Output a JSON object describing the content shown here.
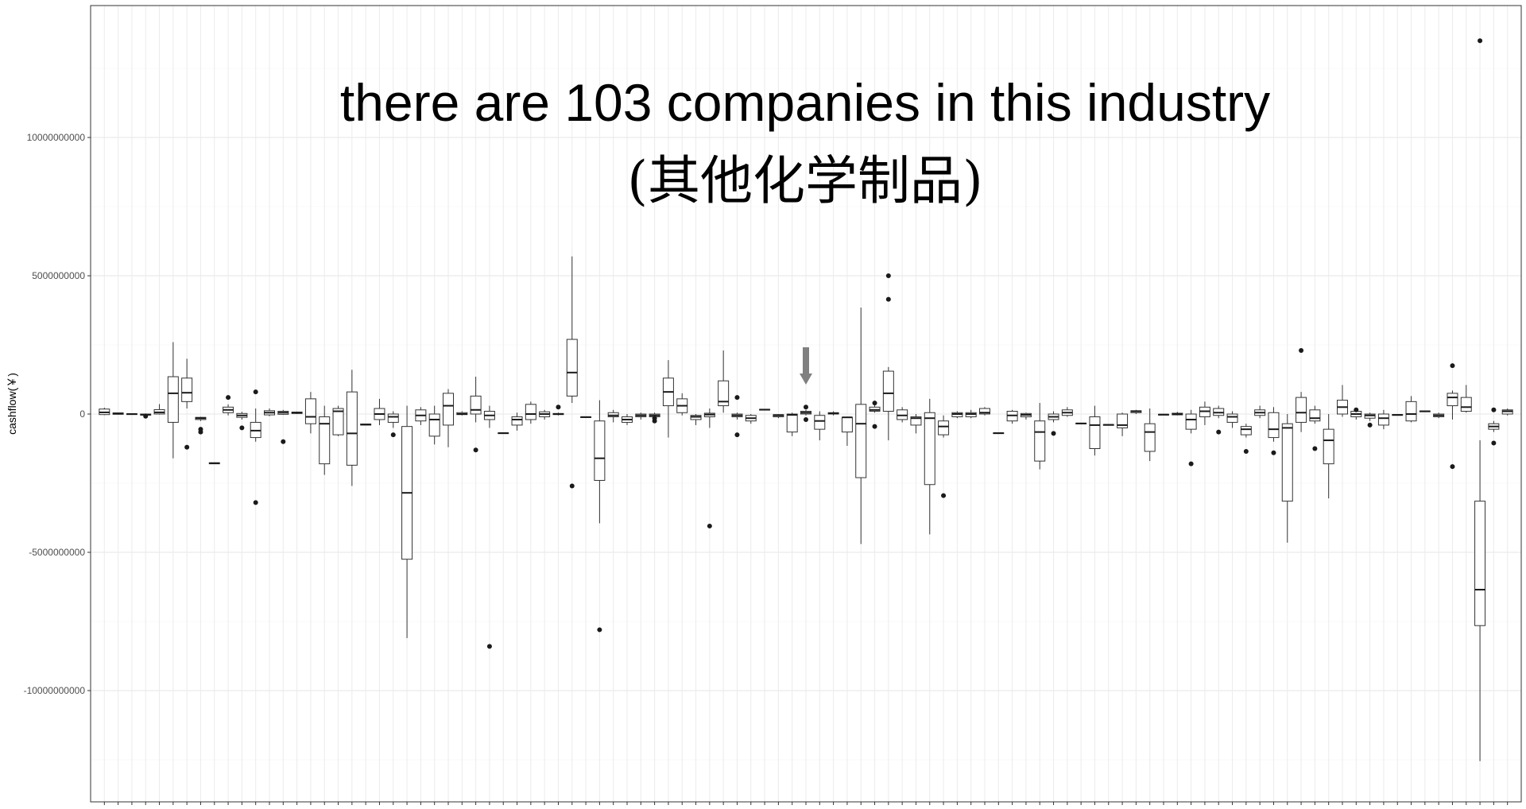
{
  "chart_data": {
    "type": "boxplot",
    "title": "there are 103 companies in this industry",
    "subtitle": "(其他化学制品)",
    "xlabel": "",
    "ylabel": "cashflow(￥)",
    "ylim": [
      -13600000000,
      14900000000
    ],
    "yticks": [
      10000000000,
      5000000000,
      0,
      -5000000000,
      -10000000000
    ],
    "ytick_labels": [
      "10000000000",
      "5000000000",
      "0",
      "-5000000000",
      "-10000000000"
    ],
    "grid": true,
    "highlight_arrow_at_index": 51,
    "boxes": [
      {
        "q1": -20000000,
        "median": 60000000,
        "q3": 180000000,
        "lo": -40000000,
        "hi": 230000000,
        "out": []
      },
      {
        "q1": -10000000,
        "median": 20000000,
        "q3": 40000000,
        "lo": -20000000,
        "hi": 50000000,
        "out": []
      },
      {
        "q1": -10000000,
        "median": 0,
        "q3": 10000000,
        "lo": -20000000,
        "hi": 20000000,
        "out": []
      },
      {
        "q1": -40000000,
        "median": -20000000,
        "q3": 0,
        "lo": -60000000,
        "hi": 20000000,
        "out": [
          -80000000
        ]
      },
      {
        "q1": 0,
        "median": 60000000,
        "q3": 160000000,
        "lo": -20000000,
        "hi": 360000000,
        "out": []
      },
      {
        "q1": -300000000,
        "median": 750000000,
        "q3": 1350000000,
        "lo": -1600000000,
        "hi": 2600000000,
        "out": []
      },
      {
        "q1": 450000000,
        "median": 770000000,
        "q3": 1300000000,
        "lo": 200000000,
        "hi": 2000000000,
        "out": [
          -1200000000
        ]
      },
      {
        "q1": -200000000,
        "median": -150000000,
        "q3": -120000000,
        "lo": -250000000,
        "hi": -100000000,
        "out": [
          -550000000,
          -650000000
        ]
      },
      {
        "q1": -1800000000,
        "median": -1780000000,
        "q3": -1760000000,
        "lo": -1800000000,
        "hi": -1760000000,
        "out": []
      },
      {
        "q1": 50000000,
        "median": 150000000,
        "q3": 250000000,
        "lo": -50000000,
        "hi": 350000000,
        "out": [
          600000000
        ]
      },
      {
        "q1": -120000000,
        "median": -50000000,
        "q3": 20000000,
        "lo": -200000000,
        "hi": 80000000,
        "out": [
          -500000000
        ]
      },
      {
        "q1": -850000000,
        "median": -600000000,
        "q3": -300000000,
        "lo": -1000000000,
        "hi": 200000000,
        "out": [
          800000000,
          -3200000000
        ]
      },
      {
        "q1": -30000000,
        "median": 50000000,
        "q3": 120000000,
        "lo": -80000000,
        "hi": 200000000,
        "out": []
      },
      {
        "q1": -10000000,
        "median": 50000000,
        "q3": 100000000,
        "lo": -30000000,
        "hi": 150000000,
        "out": [
          -1000000000
        ]
      },
      {
        "q1": 20000000,
        "median": 50000000,
        "q3": 70000000,
        "lo": 0,
        "hi": 90000000,
        "out": []
      },
      {
        "q1": -350000000,
        "median": -100000000,
        "q3": 550000000,
        "lo": -700000000,
        "hi": 800000000,
        "out": []
      },
      {
        "q1": -1800000000,
        "median": -350000000,
        "q3": -100000000,
        "lo": -2200000000,
        "hi": 300000000,
        "out": []
      },
      {
        "q1": -750000000,
        "median": 100000000,
        "q3": 200000000,
        "lo": -800000000,
        "hi": 300000000,
        "out": []
      },
      {
        "q1": -1850000000,
        "median": -700000000,
        "q3": 800000000,
        "lo": -2600000000,
        "hi": 1600000000,
        "out": []
      },
      {
        "q1": -400000000,
        "median": -380000000,
        "q3": -360000000,
        "lo": -400000000,
        "hi": -360000000,
        "out": []
      },
      {
        "q1": -200000000,
        "median": 0,
        "q3": 200000000,
        "lo": -400000000,
        "hi": 550000000,
        "out": []
      },
      {
        "q1": -300000000,
        "median": -100000000,
        "q3": 0,
        "lo": -500000000,
        "hi": 100000000,
        "out": [
          -750000000
        ]
      },
      {
        "q1": -5250000000,
        "median": -2850000000,
        "q3": -450000000,
        "lo": -8100000000,
        "hi": 300000000,
        "out": []
      },
      {
        "q1": -250000000,
        "median": -50000000,
        "q3": 150000000,
        "lo": -400000000,
        "hi": 250000000,
        "out": []
      },
      {
        "q1": -800000000,
        "median": -200000000,
        "q3": 0,
        "lo": -1100000000,
        "hi": 300000000,
        "out": []
      },
      {
        "q1": -400000000,
        "median": 300000000,
        "q3": 750000000,
        "lo": -1200000000,
        "hi": 900000000,
        "out": []
      },
      {
        "q1": -20000000,
        "median": 0,
        "q3": 50000000,
        "lo": -50000000,
        "hi": 100000000,
        "out": []
      },
      {
        "q1": 0,
        "median": 150000000,
        "q3": 650000000,
        "lo": -300000000,
        "hi": 1350000000,
        "out": [
          -1300000000
        ]
      },
      {
        "q1": -200000000,
        "median": -50000000,
        "q3": 100000000,
        "lo": -500000000,
        "hi": 300000000,
        "out": [
          -8400000000
        ]
      },
      {
        "q1": -700000000,
        "median": -690000000,
        "q3": -680000000,
        "lo": -700000000,
        "hi": -680000000,
        "out": []
      },
      {
        "q1": -400000000,
        "median": -200000000,
        "q3": -100000000,
        "lo": -600000000,
        "hi": 50000000,
        "out": []
      },
      {
        "q1": -200000000,
        "median": 0,
        "q3": 350000000,
        "lo": -350000000,
        "hi": 450000000,
        "out": []
      },
      {
        "q1": -100000000,
        "median": 0,
        "q3": 80000000,
        "lo": -200000000,
        "hi": 150000000,
        "out": []
      },
      {
        "q1": -20000000,
        "median": 0,
        "q3": 20000000,
        "lo": -50000000,
        "hi": 50000000,
        "out": [
          250000000
        ]
      },
      {
        "q1": 650000000,
        "median": 1500000000,
        "q3": 2700000000,
        "lo": 400000000,
        "hi": 5700000000,
        "out": [
          -2600000000
        ]
      },
      {
        "q1": -120000000,
        "median": -110000000,
        "q3": -100000000,
        "lo": -130000000,
        "hi": -90000000,
        "out": []
      },
      {
        "q1": -2400000000,
        "median": -1600000000,
        "q3": -250000000,
        "lo": -3950000000,
        "hi": 500000000,
        "out": [
          -7800000000
        ]
      },
      {
        "q1": -100000000,
        "median": -50000000,
        "q3": 50000000,
        "lo": -300000000,
        "hi": 150000000,
        "out": []
      },
      {
        "q1": -300000000,
        "median": -200000000,
        "q3": -100000000,
        "lo": -400000000,
        "hi": 0,
        "out": []
      },
      {
        "q1": -100000000,
        "median": -50000000,
        "q3": 0,
        "lo": -200000000,
        "hi": 50000000,
        "out": []
      },
      {
        "q1": -100000000,
        "median": -50000000,
        "q3": 0,
        "lo": -200000000,
        "hi": 50000000,
        "out": [
          -150000000,
          -250000000
        ]
      },
      {
        "q1": 300000000,
        "median": 800000000,
        "q3": 1300000000,
        "lo": -850000000,
        "hi": 1950000000,
        "out": []
      },
      {
        "q1": 50000000,
        "median": 300000000,
        "q3": 550000000,
        "lo": -50000000,
        "hi": 750000000,
        "out": []
      },
      {
        "q1": -200000000,
        "median": -100000000,
        "q3": -50000000,
        "lo": -400000000,
        "hi": 0,
        "out": []
      },
      {
        "q1": -100000000,
        "median": -20000000,
        "q3": 30000000,
        "lo": -500000000,
        "hi": 200000000,
        "out": [
          -4050000000
        ]
      },
      {
        "q1": 300000000,
        "median": 450000000,
        "q3": 1200000000,
        "lo": 50000000,
        "hi": 2300000000,
        "out": []
      },
      {
        "q1": -100000000,
        "median": -50000000,
        "q3": 0,
        "lo": -200000000,
        "hi": 50000000,
        "out": [
          600000000,
          -750000000
        ]
      },
      {
        "q1": -250000000,
        "median": -150000000,
        "q3": -50000000,
        "lo": -350000000,
        "hi": 0,
        "out": []
      },
      {
        "q1": 150000000,
        "median": 160000000,
        "q3": 170000000,
        "lo": 140000000,
        "hi": 180000000,
        "out": []
      },
      {
        "q1": -100000000,
        "median": -50000000,
        "q3": -20000000,
        "lo": -150000000,
        "hi": 0,
        "out": []
      },
      {
        "q1": -650000000,
        "median": -30000000,
        "q3": 0,
        "lo": -800000000,
        "hi": 50000000,
        "out": []
      },
      {
        "q1": 0,
        "median": 50000000,
        "q3": 100000000,
        "lo": -50000000,
        "hi": 150000000,
        "out": [
          250000000,
          -200000000
        ]
      },
      {
        "q1": -550000000,
        "median": -250000000,
        "q3": -50000000,
        "lo": -950000000,
        "hi": 100000000,
        "out": []
      },
      {
        "q1": 0,
        "median": 20000000,
        "q3": 50000000,
        "lo": -50000000,
        "hi": 100000000,
        "out": []
      },
      {
        "q1": -650000000,
        "median": -120000000,
        "q3": -120000000,
        "lo": -1150000000,
        "hi": -100000000,
        "out": []
      },
      {
        "q1": -2300000000,
        "median": -350000000,
        "q3": 350000000,
        "lo": -4700000000,
        "hi": 3850000000,
        "out": []
      },
      {
        "q1": 100000000,
        "median": 150000000,
        "q3": 250000000,
        "lo": 50000000,
        "hi": 350000000,
        "out": [
          400000000,
          -450000000
        ]
      },
      {
        "q1": 100000000,
        "median": 750000000,
        "q3": 1550000000,
        "lo": -950000000,
        "hi": 1700000000,
        "out": [
          5000000000,
          4150000000
        ]
      },
      {
        "q1": -200000000,
        "median": -50000000,
        "q3": 150000000,
        "lo": -300000000,
        "hi": 250000000,
        "out": []
      },
      {
        "q1": -400000000,
        "median": -150000000,
        "q3": -100000000,
        "lo": -700000000,
        "hi": 0,
        "out": []
      },
      {
        "q1": -2550000000,
        "median": -150000000,
        "q3": 50000000,
        "lo": -4350000000,
        "hi": 550000000,
        "out": []
      },
      {
        "q1": -750000000,
        "median": -450000000,
        "q3": -250000000,
        "lo": -850000000,
        "hi": -50000000,
        "out": [
          -2950000000
        ]
      },
      {
        "q1": -100000000,
        "median": 0,
        "q3": 50000000,
        "lo": -150000000,
        "hi": 100000000,
        "out": []
      },
      {
        "q1": -100000000,
        "median": 0,
        "q3": 50000000,
        "lo": -150000000,
        "hi": 150000000,
        "out": []
      },
      {
        "q1": 0,
        "median": 50000000,
        "q3": 200000000,
        "lo": -50000000,
        "hi": 250000000,
        "out": []
      },
      {
        "q1": -700000000,
        "median": -690000000,
        "q3": -680000000,
        "lo": -700000000,
        "hi": -680000000,
        "out": []
      },
      {
        "q1": -250000000,
        "median": -50000000,
        "q3": 100000000,
        "lo": -350000000,
        "hi": 150000000,
        "out": []
      },
      {
        "q1": -100000000,
        "median": -30000000,
        "q3": 20000000,
        "lo": -200000000,
        "hi": 50000000,
        "out": []
      },
      {
        "q1": -1700000000,
        "median": -650000000,
        "q3": -250000000,
        "lo": -2000000000,
        "hi": 400000000,
        "out": []
      },
      {
        "q1": -200000000,
        "median": -100000000,
        "q3": 0,
        "lo": -300000000,
        "hi": 100000000,
        "out": [
          -700000000
        ]
      },
      {
        "q1": -50000000,
        "median": 50000000,
        "q3": 150000000,
        "lo": -100000000,
        "hi": 250000000,
        "out": []
      },
      {
        "q1": -350000000,
        "median": -340000000,
        "q3": -330000000,
        "lo": -350000000,
        "hi": -330000000,
        "out": []
      },
      {
        "q1": -1250000000,
        "median": -400000000,
        "q3": -100000000,
        "lo": -1500000000,
        "hi": 300000000,
        "out": []
      },
      {
        "q1": -400000000,
        "median": -390000000,
        "q3": -380000000,
        "lo": -400000000,
        "hi": -380000000,
        "out": []
      },
      {
        "q1": -500000000,
        "median": -400000000,
        "q3": 0,
        "lo": -800000000,
        "hi": 50000000,
        "out": []
      },
      {
        "q1": 50000000,
        "median": 100000000,
        "q3": 120000000,
        "lo": 0,
        "hi": 150000000,
        "out": []
      },
      {
        "q1": -1350000000,
        "median": -650000000,
        "q3": -350000000,
        "lo": -1700000000,
        "hi": 200000000,
        "out": []
      },
      {
        "q1": -30000000,
        "median": -20000000,
        "q3": -10000000,
        "lo": -40000000,
        "hi": 0,
        "out": []
      },
      {
        "q1": -30000000,
        "median": 0,
        "q3": 30000000,
        "lo": -50000000,
        "hi": 80000000,
        "out": []
      },
      {
        "q1": -550000000,
        "median": -200000000,
        "q3": 0,
        "lo": -700000000,
        "hi": 150000000,
        "out": [
          -1800000000
        ]
      },
      {
        "q1": -100000000,
        "median": 100000000,
        "q3": 250000000,
        "lo": -400000000,
        "hi": 450000000,
        "out": []
      },
      {
        "q1": -50000000,
        "median": 50000000,
        "q3": 200000000,
        "lo": -150000000,
        "hi": 300000000,
        "out": [
          -650000000
        ]
      },
      {
        "q1": -300000000,
        "median": -100000000,
        "q3": 0,
        "lo": -500000000,
        "hi": 100000000,
        "out": []
      },
      {
        "q1": -750000000,
        "median": -550000000,
        "q3": -450000000,
        "lo": -850000000,
        "hi": -350000000,
        "out": [
          -1350000000
        ]
      },
      {
        "q1": -50000000,
        "median": 50000000,
        "q3": 150000000,
        "lo": -150000000,
        "hi": 300000000,
        "out": []
      },
      {
        "q1": -850000000,
        "median": -550000000,
        "q3": 50000000,
        "lo": -1000000000,
        "hi": 250000000,
        "out": [
          -1400000000
        ]
      },
      {
        "q1": -3150000000,
        "median": -500000000,
        "q3": -350000000,
        "lo": -4650000000,
        "hi": 0,
        "out": []
      },
      {
        "q1": -300000000,
        "median": 50000000,
        "q3": 600000000,
        "lo": -650000000,
        "hi": 800000000,
        "out": [
          2300000000
        ]
      },
      {
        "q1": -250000000,
        "median": -150000000,
        "q3": 150000000,
        "lo": -350000000,
        "hi": 300000000,
        "out": [
          -1250000000
        ]
      },
      {
        "q1": -1800000000,
        "median": -950000000,
        "q3": -550000000,
        "lo": -3050000000,
        "hi": 0,
        "out": []
      },
      {
        "q1": 0,
        "median": 250000000,
        "q3": 500000000,
        "lo": -100000000,
        "hi": 1050000000,
        "out": []
      },
      {
        "q1": -100000000,
        "median": 0,
        "q3": 100000000,
        "lo": -200000000,
        "hi": 150000000,
        "out": [
          150000000
        ]
      },
      {
        "q1": -150000000,
        "median": -50000000,
        "q3": 0,
        "lo": -250000000,
        "hi": 50000000,
        "out": [
          -400000000
        ]
      },
      {
        "q1": -400000000,
        "median": -150000000,
        "q3": 0,
        "lo": -550000000,
        "hi": 150000000,
        "out": []
      },
      {
        "q1": -40000000,
        "median": -30000000,
        "q3": -20000000,
        "lo": -50000000,
        "hi": -10000000,
        "out": []
      },
      {
        "q1": -250000000,
        "median": 0,
        "q3": 450000000,
        "lo": -300000000,
        "hi": 650000000,
        "out": []
      },
      {
        "q1": 90000000,
        "median": 100000000,
        "q3": 110000000,
        "lo": 80000000,
        "hi": 120000000,
        "out": []
      },
      {
        "q1": -100000000,
        "median": -50000000,
        "q3": 0,
        "lo": -150000000,
        "hi": 50000000,
        "out": []
      },
      {
        "q1": 300000000,
        "median": 600000000,
        "q3": 750000000,
        "lo": -200000000,
        "hi": 850000000,
        "out": [
          1750000000,
          -1900000000
        ]
      },
      {
        "q1": 100000000,
        "median": 250000000,
        "q3": 600000000,
        "lo": 50000000,
        "hi": 1050000000,
        "out": []
      },
      {
        "q1": -7650000000,
        "median": -6350000000,
        "q3": -3150000000,
        "lo": -12550000000,
        "hi": -950000000,
        "out": [
          13500000000
        ]
      },
      {
        "q1": -550000000,
        "median": -450000000,
        "q3": -350000000,
        "lo": -650000000,
        "hi": -250000000,
        "out": [
          150000000,
          -1050000000
        ]
      },
      {
        "q1": 0,
        "median": 100000000,
        "q3": 150000000,
        "lo": -50000000,
        "hi": 200000000,
        "out": []
      }
    ]
  }
}
